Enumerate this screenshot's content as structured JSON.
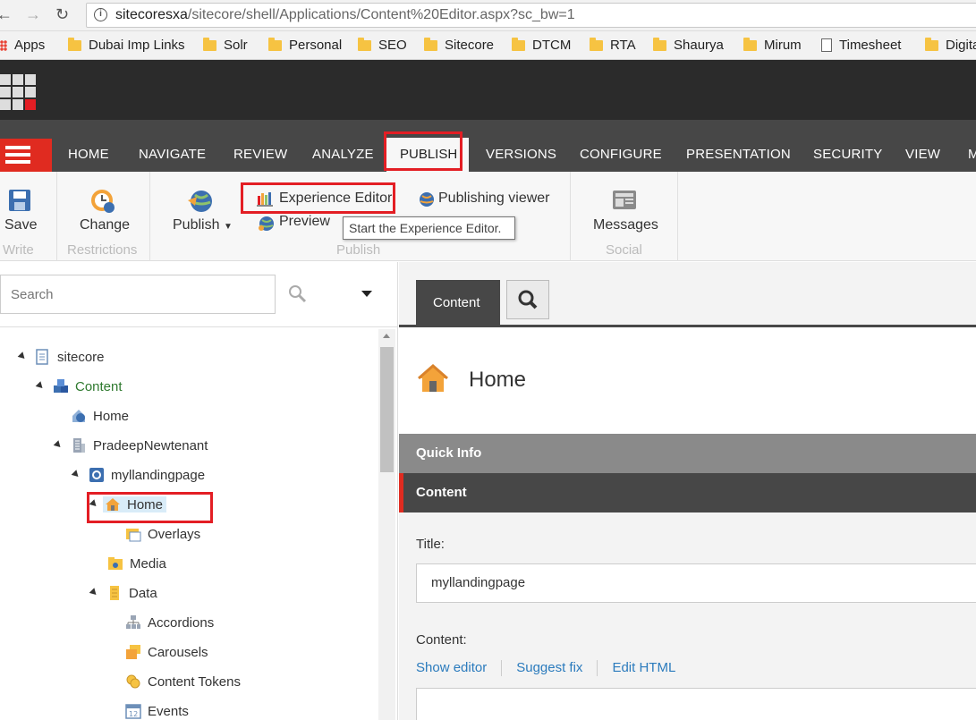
{
  "browser": {
    "url_host": "sitecoresxa",
    "url_path": "/sitecore/shell/Applications/Content%20Editor.aspx?sc_bw=1",
    "bookmarks": [
      "Apps",
      "Dubai Imp Links",
      "Solr",
      "Personal",
      "SEO",
      "Sitecore",
      "DTCM",
      "RTA",
      "Shaurya",
      "Mirum",
      "Timesheet",
      "Digita"
    ]
  },
  "tabs": [
    "HOME",
    "NAVIGATE",
    "REVIEW",
    "ANALYZE",
    "PUBLISH",
    "VERSIONS",
    "CONFIGURE",
    "PRESENTATION",
    "SECURITY",
    "VIEW",
    "M"
  ],
  "active_tab": "PUBLISH",
  "ribbon": {
    "save": "Save",
    "write_group": "Write",
    "change": "Change",
    "restrictions_group": "Restrictions",
    "publish": "Publish",
    "experience_editor": "Experience Editor",
    "preview": "Preview",
    "publishing_viewer": "Publishing viewer",
    "publish_group": "Publish",
    "messages": "Messages",
    "social_group": "Social",
    "tooltip": "Start the Experience Editor."
  },
  "search": {
    "placeholder": "Search"
  },
  "tree": {
    "sitecore": "sitecore",
    "content": "Content",
    "home_root": "Home",
    "tenant": "PradeepNewtenant",
    "site": "myllandingpage",
    "home_selected": "Home",
    "overlays": "Overlays",
    "media": "Media",
    "data": "Data",
    "accordions": "Accordions",
    "carousels": "Carousels",
    "content_tokens": "Content Tokens",
    "events": "Events"
  },
  "editor": {
    "content_tab": "Content",
    "item_title": "Home",
    "quick_info": "Quick Info",
    "content_section": "Content",
    "title_label": "Title:",
    "title_value": "myllandingpage",
    "content_label": "Content:",
    "show_editor": "Show editor",
    "suggest_fix": "Suggest fix",
    "edit_html": "Edit HTML"
  },
  "colors": {
    "accent_red": "#e02b20",
    "dark_bar": "#474747",
    "link": "#2b7bbd"
  }
}
